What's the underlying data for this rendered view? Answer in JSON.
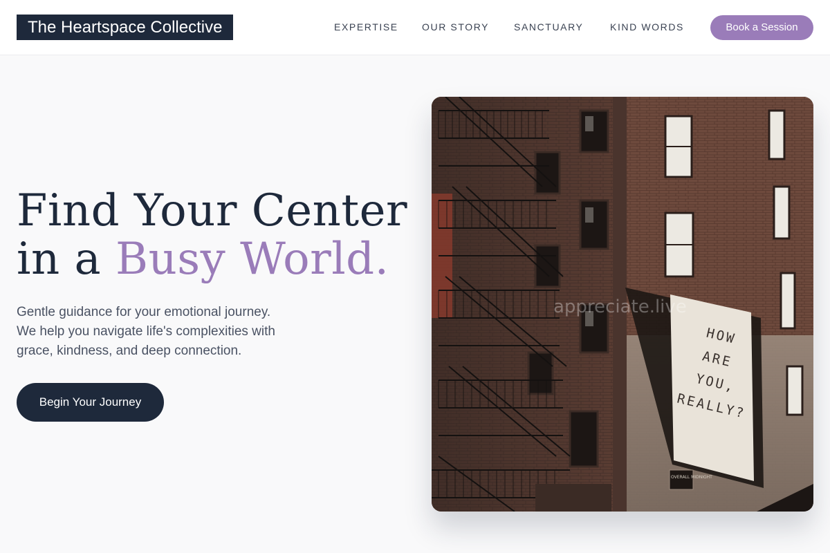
{
  "header": {
    "logo": "The Heartspace Collective",
    "nav": [
      "EXPERTISE",
      "OUR STORY",
      "SANCTUARY",
      "KIND WORDS"
    ],
    "book_label": "Book a Session"
  },
  "hero": {
    "title_line1": "Find Your Center",
    "title_line2_prefix": "in a ",
    "title_line2_accent": "Busy World.",
    "subtitle": [
      "Gentle guidance for your emotional journey.",
      "We help you navigate life's complexities with",
      "grace, kindness, and deep connection."
    ],
    "cta_label": "Begin Your Journey"
  },
  "photo": {
    "mural_text": [
      "HOW",
      "ARE",
      "YOU,",
      "REALLY?"
    ],
    "overlay_text": "appreciate.live",
    "sign_text": "OVERALL MIDNIGHT"
  },
  "colors": {
    "navy": "#1e293b",
    "lavender": "#9a7cb9",
    "background": "#f9f9fa",
    "body_text": "#4a5263"
  }
}
